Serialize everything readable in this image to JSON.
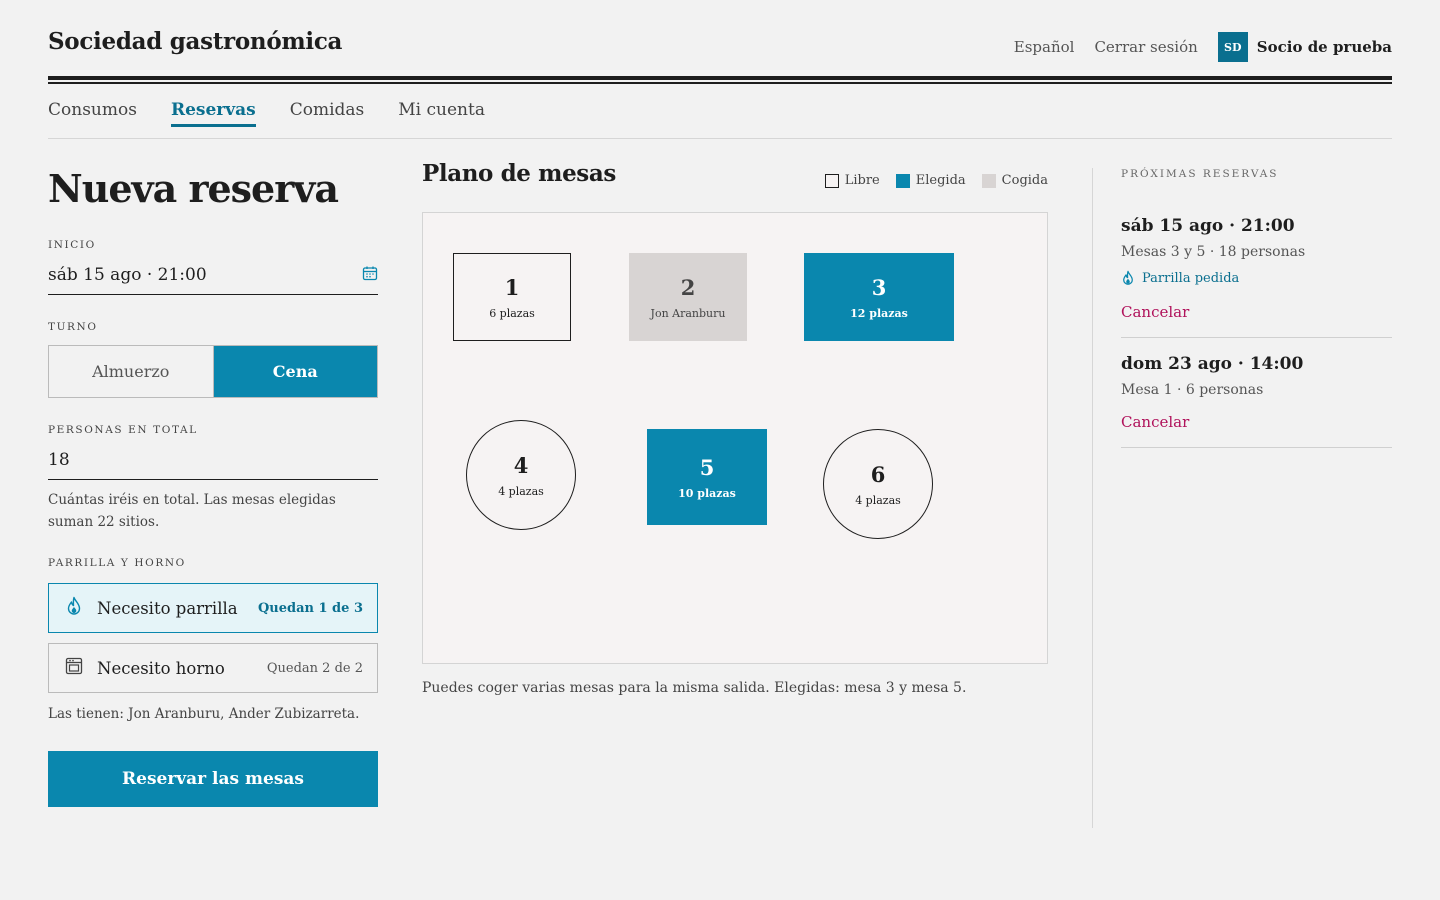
{
  "header": {
    "brand": "Sociedad gastronómica",
    "language": "Español",
    "logout": "Cerrar sesión",
    "avatar_initials": "SD",
    "user_name": "Socio de prueba"
  },
  "nav": {
    "items": [
      "Consumos",
      "Reservas",
      "Comidas",
      "Mi cuenta"
    ],
    "active": "Reservas"
  },
  "form": {
    "title": "Nueva reserva",
    "start_label": "INICIO",
    "start_value": "sáb 15 ago · 21:00",
    "start_icon": "calendar-icon",
    "shift_label": "TURNO",
    "shift_options": [
      "Almuerzo",
      "Cena"
    ],
    "shift_selected": "Cena",
    "people_label": "PERSONAS EN TOTAL",
    "people_value": "18",
    "people_help": "Cuántas iréis en total. Las mesas elegidas suman 22 sitios.",
    "equipment_label": "PARRILLA Y HORNO",
    "grill": {
      "label": "Necesito parrilla",
      "count": "Quedan 1 de 3",
      "selected": true,
      "icon": "flame-icon"
    },
    "oven": {
      "label": "Necesito horno",
      "count": "Quedan 2 de 2",
      "selected": false,
      "icon": "oven-icon"
    },
    "holders_note": "Las tienen: Jon Aranburu, Ander Zubizarreta.",
    "submit": "Reservar las mesas"
  },
  "plan": {
    "title": "Plano de mesas",
    "legend": {
      "free": "Libre",
      "chosen": "Elegida",
      "taken": "Cogida"
    },
    "tables": [
      {
        "number": "1",
        "detail": "6 plazas",
        "state": "free"
      },
      {
        "number": "2",
        "detail": "Jon Aranburu",
        "state": "taken"
      },
      {
        "number": "3",
        "detail": "12 plazas",
        "state": "chosen"
      },
      {
        "number": "4",
        "detail": "4 plazas",
        "state": "free"
      },
      {
        "number": "5",
        "detail": "10 plazas",
        "state": "chosen"
      },
      {
        "number": "6",
        "detail": "4 plazas",
        "state": "free"
      }
    ],
    "note": "Puedes coger varias mesas para la misma salida. Elegidas: mesa 3 y mesa 5."
  },
  "upcoming": {
    "title": "PRÓXIMAS RESERVAS",
    "items": [
      {
        "when": "sáb 15 ago · 21:00",
        "detail": "Mesas 3 y 5 · 18 personas",
        "flag": "Parrilla pedida",
        "cancel": "Cancelar"
      },
      {
        "when": "dom 23 ago · 14:00",
        "detail": "Mesa 1 · 6 personas",
        "cancel": "Cancelar"
      }
    ]
  },
  "colors": {
    "accent": "#0a87ae",
    "accent_dark": "#0a6f8f",
    "taken": "#d8d4d3",
    "danger": "#b0125b"
  }
}
